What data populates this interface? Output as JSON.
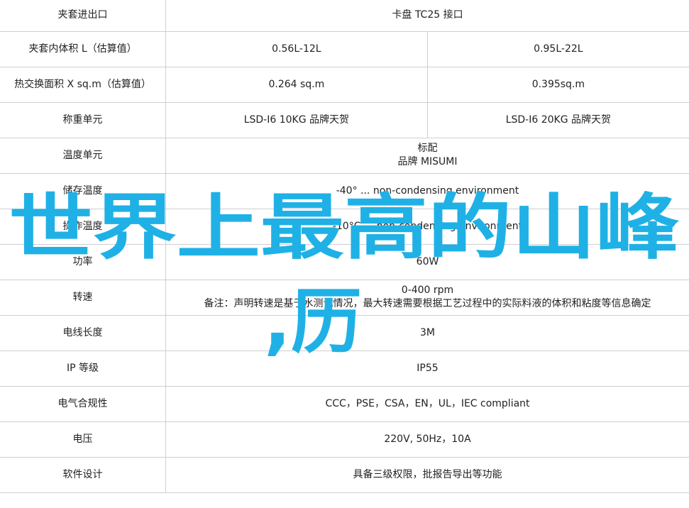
{
  "rows": [
    {
      "label": "夹套进出口",
      "value": "卡盘 TC25 接口"
    },
    {
      "label": "夹套内体积 L（估算值）",
      "col1": "0.56L-12L",
      "col2": "0.95L-22L"
    },
    {
      "label": "热交换面积 X sq.m（估算值）",
      "col1": "0.264 sq.m",
      "col2": "0.395sq.m"
    },
    {
      "label": "称重单元",
      "col1": "LSD-I6 10KG 品牌天贺",
      "col2": "LSD-I6 20KG 品牌天贺"
    },
    {
      "label": "温度单元",
      "line1": "标配",
      "line2": "品牌 MISUMI"
    },
    {
      "label": "储存温度",
      "value": "-40° ... non-condensing environment"
    },
    {
      "label": "操作温度",
      "value": "-10°C ... non-condensing environment"
    },
    {
      "label": "功率",
      "value": "60W"
    },
    {
      "label": "转速",
      "line1": "0-400 rpm",
      "line2": "备注：声明转速是基于水测试情况，最大转速需要根据工艺过程中的实际料液的体积和粘度等信息确定"
    },
    {
      "label": "电线长度",
      "value": "3M"
    },
    {
      "label": "IP 等级",
      "value": "IP55"
    },
    {
      "label": "电气合规性",
      "value": "CCC，PSE，CSA，EN，UL，IEC compliant"
    },
    {
      "label": "电压",
      "value": "220V, 50Hz，10A"
    },
    {
      "label": "软件设计",
      "value": "具备三级权限，批报告导出等功能"
    }
  ],
  "overlay": {
    "line1": "世界上最高的山峰",
    "line2": ",历",
    "color": "#1fb1e6"
  }
}
